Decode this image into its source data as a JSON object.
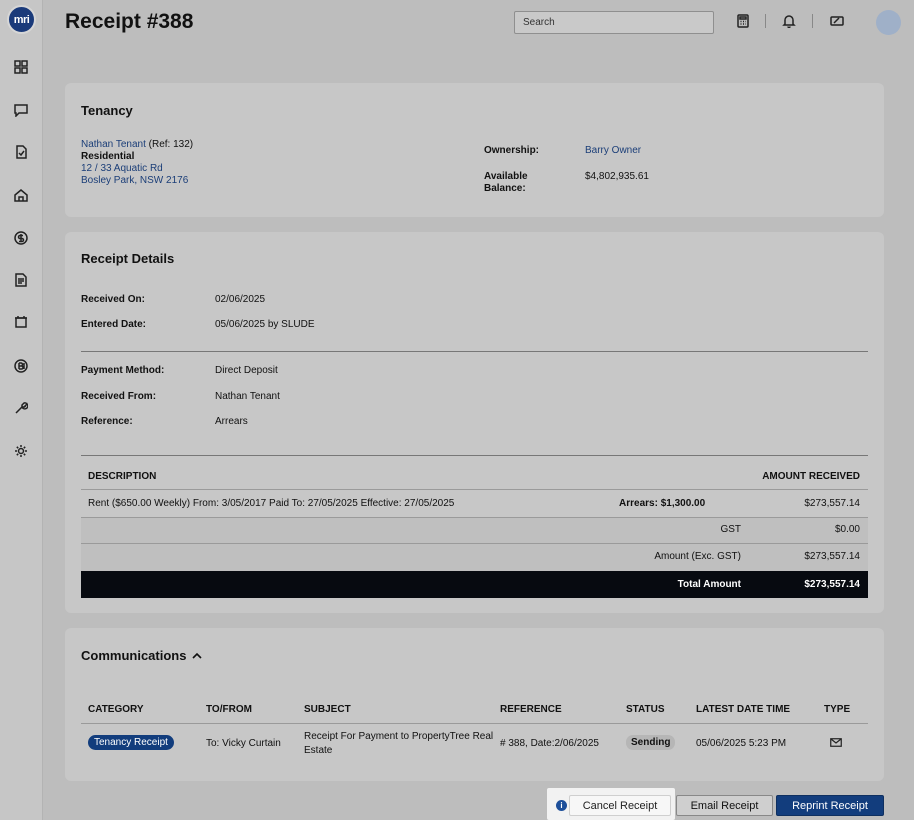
{
  "app": {
    "logo_text": "mri"
  },
  "header": {
    "title": "Receipt #388",
    "search_placeholder": "Search"
  },
  "tenancy": {
    "heading": "Tenancy",
    "tenant_name": "Nathan Tenant",
    "tenant_ref": "(Ref: 132)",
    "type": "Residential",
    "address_line1": "12 / 33 Aquatic Rd",
    "address_line2": "Bosley Park, NSW 2176",
    "ownership_label": "Ownership:",
    "ownership_value": "Barry Owner",
    "balance_label_1": "Available",
    "balance_label_2": "Balance:",
    "balance_value": "$4,802,935.61"
  },
  "receipt": {
    "heading": "Receipt Details",
    "received_on_label": "Received On:",
    "received_on_value": "02/06/2025",
    "entered_label": "Entered Date:",
    "entered_value": "05/06/2025 by SLUDE",
    "method_label": "Payment Method:",
    "method_value": "Direct Deposit",
    "from_label": "Received From:",
    "from_value": "Nathan Tenant",
    "reference_label": "Reference:",
    "reference_value": "Arrears",
    "table": {
      "col_description": "DESCRIPTION",
      "col_amount": "AMOUNT RECEIVED",
      "line_description": "Rent ($650.00 Weekly) From: 3/05/2017 Paid To: 27/05/2025 Effective: 27/05/2025",
      "line_arrears": "Arrears: $1,300.00",
      "line_amount": "$273,557.14",
      "gst_label": "GST",
      "gst_value": "$0.00",
      "excl_label": "Amount (Exc. GST)",
      "excl_value": "$273,557.14",
      "total_label": "Total Amount",
      "total_value": "$273,557.14"
    }
  },
  "communications": {
    "heading": "Communications",
    "columns": [
      "CATEGORY",
      "TO/FROM",
      "SUBJECT",
      "REFERENCE",
      "STATUS",
      "LATEST DATE TIME",
      "TYPE"
    ],
    "row": {
      "category": "Tenancy Receipt",
      "to_from": "To: Vicky Curtain",
      "subject_line1": "Receipt For Payment to PropertyTree Real",
      "subject_line2": "Estate",
      "reference": "# 388, Date:2/06/2025",
      "status": "Sending",
      "datetime": "05/06/2025 5:23 PM"
    }
  },
  "actions": {
    "cancel": "Cancel Receipt",
    "email": "Email Receipt",
    "reprint": "Reprint Receipt",
    "info_glyph": "i"
  }
}
